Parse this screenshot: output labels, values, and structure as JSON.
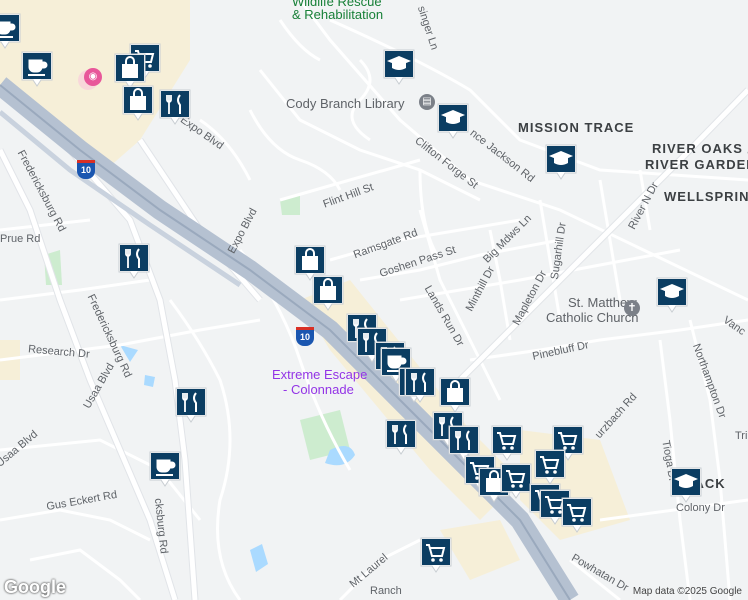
{
  "map": {
    "attribution": "Map data ©2025 Google",
    "logo": "Google",
    "interstate_shield": "10",
    "area_labels": [
      {
        "text": "MISSION TRACE"
      },
      {
        "text": "RIVER OAKS /"
      },
      {
        "text": "RIVER GARDEN"
      },
      {
        "text": "WELLSPRING"
      },
      {
        "text": "V  JACK"
      }
    ],
    "poi_labels": [
      {
        "text": "Wildlife Rescue",
        "color": "#188038"
      },
      {
        "text": "& Rehabilitation",
        "color": "#188038"
      },
      {
        "text": "Cody Branch Library",
        "color": "#5f6368"
      },
      {
        "text": "St. Matthew",
        "color": "#5f6368"
      },
      {
        "text": "Catholic Church",
        "color": "#5f6368"
      },
      {
        "text": "Extreme Escape",
        "color": "#9334e6"
      },
      {
        "text": "- Colonnade",
        "color": "#9334e6"
      }
    ],
    "street_labels": [
      {
        "text": "Expo Blvd"
      },
      {
        "text": "Expo Blvd"
      },
      {
        "text": "Flint Hill St"
      },
      {
        "text": "Fredericksburg Rd"
      },
      {
        "text": "Fredericksburg Rd"
      },
      {
        "text": "Prue Rd"
      },
      {
        "text": "Research Dr"
      },
      {
        "text": "Usaa Blvd"
      },
      {
        "text": "Usaa Blvd"
      },
      {
        "text": "Gus Eckert Rd"
      },
      {
        "text": "cksburg Rd"
      },
      {
        "text": "Clifton Forge St"
      },
      {
        "text": "nce Jackson Rd"
      },
      {
        "text": "Ramsgate Rd"
      },
      {
        "text": "Goshen Pass St"
      },
      {
        "text": "Big Mdws Ln"
      },
      {
        "text": "Minthill Dr"
      },
      {
        "text": "Mapleton Dr"
      },
      {
        "text": "Lands Run Dr"
      },
      {
        "text": "Sugarhill Dr"
      },
      {
        "text": "River N Dr"
      },
      {
        "text": "Pinebluff Dr"
      },
      {
        "text": "Northampton Dr"
      },
      {
        "text": "urzbach Rd"
      },
      {
        "text": "Tioga Dr"
      },
      {
        "text": "Colony Dr"
      },
      {
        "text": "Powhatan Dr"
      },
      {
        "text": "Mt Laurel"
      },
      {
        "text": "Ranch"
      },
      {
        "text": "singer Ln"
      },
      {
        "text": "Tri"
      },
      {
        "text": "Vanc"
      }
    ],
    "markers": [
      {
        "icon": "coffee-icon"
      },
      {
        "icon": "coffee-icon"
      },
      {
        "icon": "shopping-cart-icon"
      },
      {
        "icon": "shopping-bag-icon"
      },
      {
        "icon": "shopping-bag-icon"
      },
      {
        "icon": "restaurant-icon"
      },
      {
        "icon": "school-icon"
      },
      {
        "icon": "school-icon"
      },
      {
        "icon": "school-icon"
      },
      {
        "icon": "school-icon"
      },
      {
        "icon": "school-icon"
      },
      {
        "icon": "restaurant-icon"
      },
      {
        "icon": "shopping-bag-icon"
      },
      {
        "icon": "shopping-bag-icon"
      },
      {
        "icon": "restaurant-icon"
      },
      {
        "icon": "restaurant-icon"
      },
      {
        "icon": "restaurant-icon"
      },
      {
        "icon": "coffee-icon"
      },
      {
        "icon": "restaurant-icon"
      },
      {
        "icon": "restaurant-icon"
      },
      {
        "icon": "shopping-bag-icon"
      },
      {
        "icon": "restaurant-icon"
      },
      {
        "icon": "restaurant-icon"
      },
      {
        "icon": "restaurant-icon"
      },
      {
        "icon": "restaurant-icon"
      },
      {
        "icon": "shopping-cart-icon"
      },
      {
        "icon": "shopping-cart-icon"
      },
      {
        "icon": "shopping-cart-icon"
      },
      {
        "icon": "shopping-cart-icon"
      },
      {
        "icon": "shopping-bag-icon"
      },
      {
        "icon": "shopping-cart-icon"
      },
      {
        "icon": "shopping-cart-icon"
      },
      {
        "icon": "shopping-cart-icon"
      },
      {
        "icon": "shopping-cart-icon"
      },
      {
        "icon": "coffee-icon"
      },
      {
        "icon": "shopping-cart-icon"
      }
    ]
  }
}
